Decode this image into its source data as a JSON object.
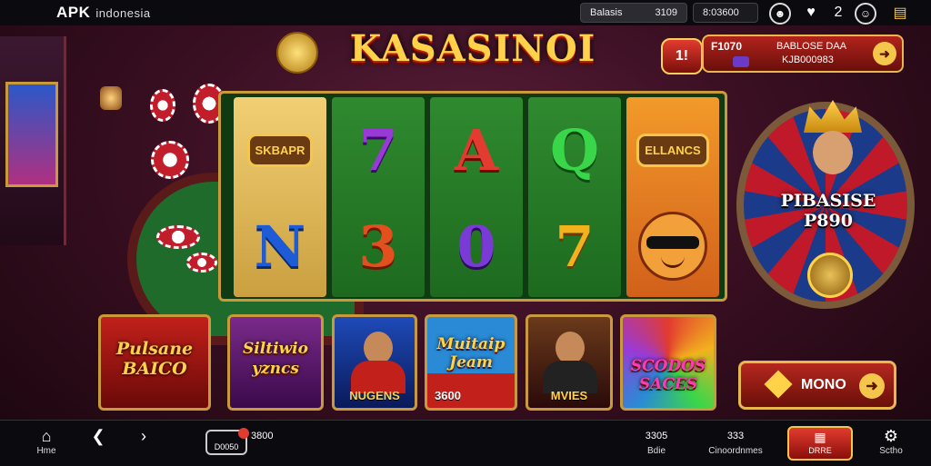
{
  "topbar": {
    "brand": "APK",
    "brand_sub": "indonesia",
    "balance_label": "Balasis",
    "balance_value": "3109",
    "coins_value": "8:03600",
    "icons": [
      "profile-icon",
      "heart-icon",
      "ranking-icon",
      "user-icon",
      "gift-icon"
    ],
    "rank_value": "2"
  },
  "logo": "KASASINOI",
  "jackpot": {
    "button": "1!",
    "amount": "F1070",
    "label": "BABLOSE DAA",
    "sub": "KJB000983"
  },
  "reels": [
    [
      "SKBAPR",
      "N"
    ],
    [
      "7",
      "3"
    ],
    [
      "A",
      "0"
    ],
    [
      "Q",
      "7"
    ],
    [
      "ELLANCS",
      "smiley"
    ]
  ],
  "wheel": {
    "label_line1": "PIBASISE",
    "label_line2": "P890"
  },
  "tiles": [
    {
      "title": "Pulsane BAICO",
      "caption": ""
    },
    {
      "title": "Siltiwio yzncs",
      "caption": ""
    },
    {
      "title": "",
      "caption": "NUGENS"
    },
    {
      "title": "Muitaip Jeam",
      "caption": "3600"
    },
    {
      "title": "",
      "caption": "MVIES"
    },
    {
      "title": "SCODOS SACES",
      "caption": ""
    }
  ],
  "mono_button": "MONO",
  "bottom_nav": {
    "home": "Hme",
    "wallet_label": "D0050",
    "wallet_amount": "3800",
    "bonus_value": "3305",
    "bonus_label": "Bdie",
    "promos_value": "333",
    "promos_label": "Cinoordnmes",
    "active_label": "DRRE",
    "settings_label": "Sctho"
  },
  "colors": {
    "accent_gold": "#ffd24a",
    "accent_red": "#b5281e",
    "felt_green": "#1f6b2b"
  }
}
